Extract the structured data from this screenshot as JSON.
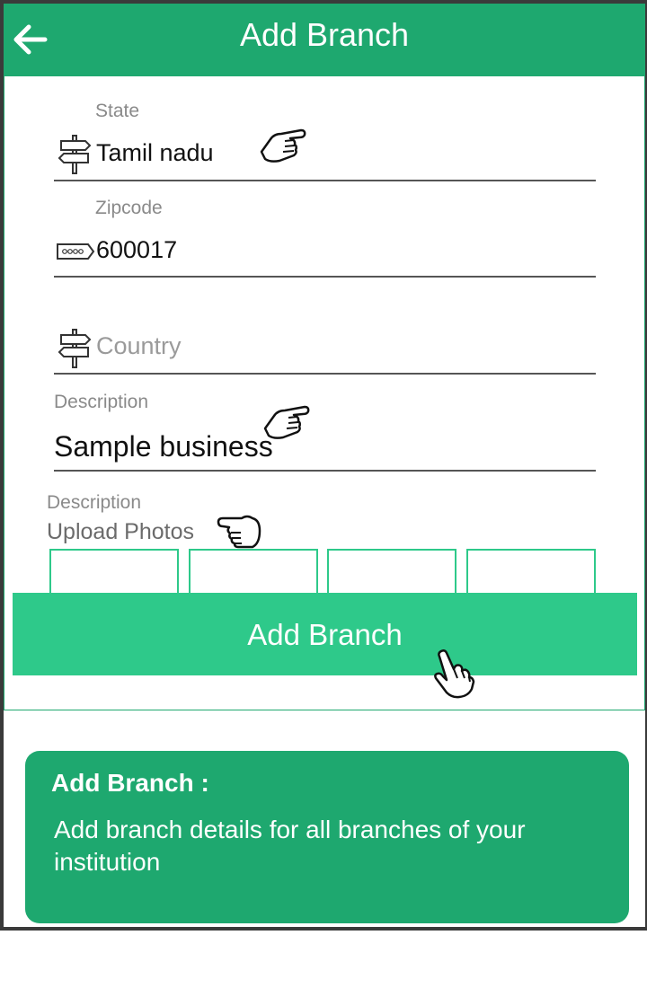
{
  "appbar": {
    "title": "Add Branch",
    "back_icon": "arrow-left-icon"
  },
  "form": {
    "state": {
      "label": "State",
      "value": "Tamil nadu",
      "icon": "signpost-icon"
    },
    "zipcode": {
      "label": "Zipcode",
      "value": "600017",
      "icon": "pin-code-icon"
    },
    "country": {
      "placeholder": "Country",
      "icon": "signpost-icon"
    },
    "description": {
      "label": "Description",
      "value": "Sample business"
    },
    "photos": {
      "label": "Description",
      "title": "Upload Photos",
      "slot_count": 4
    }
  },
  "add_button": {
    "label": "Add Branch"
  },
  "info_card": {
    "title": "Add Branch :",
    "text": "Add branch details for all branches of your institution"
  },
  "colors": {
    "primary": "#1ea86f",
    "button": "#2ec98a",
    "slot_border": "#2ec98a"
  }
}
